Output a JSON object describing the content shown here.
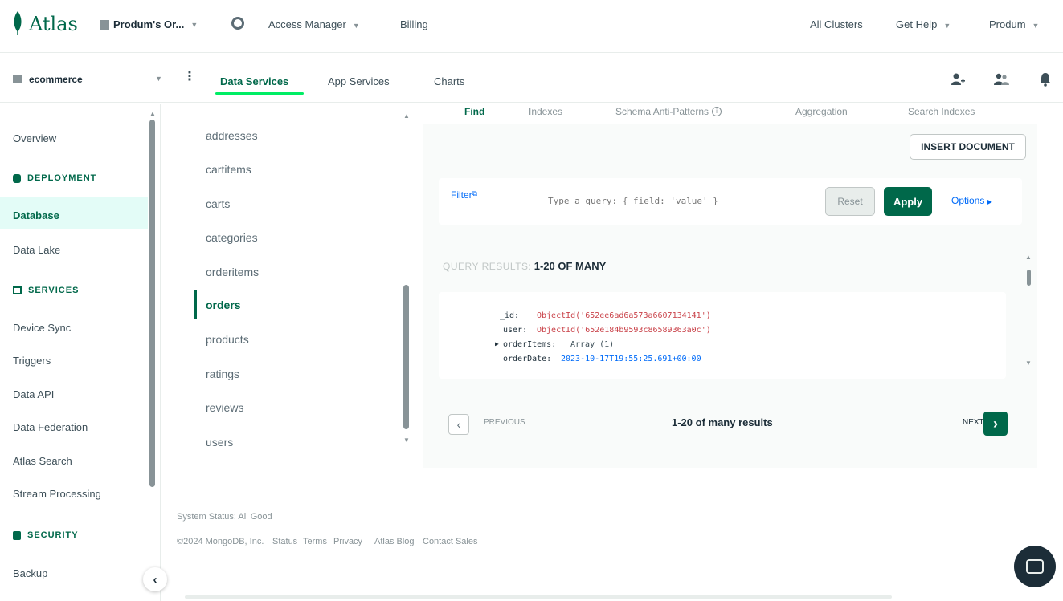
{
  "topbar": {
    "brand": "Atlas",
    "org": "Produm's Or...",
    "access_manager": "Access Manager",
    "billing": "Billing",
    "all_clusters": "All Clusters",
    "get_help": "Get Help",
    "user": "Produm"
  },
  "subbar": {
    "project": "ecommerce",
    "tabs": [
      "Data Services",
      "App Services",
      "Charts"
    ]
  },
  "leftnav": {
    "overview": "Overview",
    "deployment": "DEPLOYMENT",
    "database": "Database",
    "data_lake": "Data Lake",
    "services": "SERVICES",
    "device_sync": "Device Sync",
    "triggers": "Triggers",
    "data_api": "Data API",
    "data_federation": "Data Federation",
    "atlas_search": "Atlas Search",
    "stream_processing": "Stream Processing",
    "security": "SECURITY",
    "backup": "Backup"
  },
  "collections": [
    "addresses",
    "cartitems",
    "carts",
    "categories",
    "orderitems",
    "orders",
    "products",
    "ratings",
    "reviews",
    "users"
  ],
  "active_collection": "orders",
  "tabs": [
    "Find",
    "Indexes",
    "Schema Anti-Patterns",
    "Aggregation",
    "Search Indexes"
  ],
  "insert_document": "INSERT DOCUMENT",
  "filter": {
    "label": "Filter",
    "placeholder": "Type a query: { field: 'value' }",
    "reset": "Reset",
    "apply": "Apply",
    "options": "Options"
  },
  "results": {
    "label": "QUERY RESULTS:",
    "range": "1-20 OF MANY"
  },
  "document": {
    "id_key": "_id:",
    "id_val": "ObjectId('652ee6ad6a573a6607134141')",
    "user_key": "user:",
    "user_val": "ObjectId('652e184b9593c86589363a0c')",
    "items_key": "orderItems:",
    "items_val": "Array (1)",
    "date_key": "orderDate:",
    "date_val": "2023-10-17T19:55:25.691+00:00"
  },
  "pager": {
    "previous": "PREVIOUS",
    "summary": "1-20 of many results",
    "next": "NEXT"
  },
  "footer": {
    "status": "System Status: All Good",
    "copyright": "©2024 MongoDB, Inc.",
    "links": [
      "Status",
      "Terms",
      "Privacy",
      "Atlas Blog",
      "Contact Sales"
    ]
  },
  "colors": {
    "brand_green": "#00684a",
    "apply_green": "#00684a",
    "active_bg": "#e3fcf7"
  }
}
